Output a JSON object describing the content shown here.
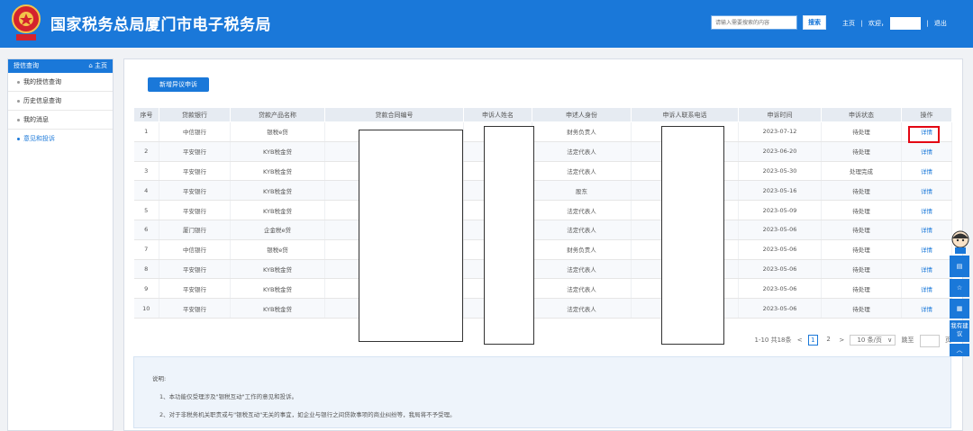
{
  "header": {
    "title": "国家税务总局厦门市电子税务局",
    "search_placeholder": "请输入需要搜索的内容",
    "search_button": "搜索",
    "nav_home": "主页",
    "nav_welcome": "欢迎，",
    "nav_logout": "退出",
    "sep": "|"
  },
  "sidebar": {
    "header": "授信查询",
    "home_link": "主页",
    "items": [
      {
        "label": "我的授信查询"
      },
      {
        "label": "历史信息查询"
      },
      {
        "label": "我的消息"
      },
      {
        "label": "意见和投诉"
      }
    ]
  },
  "main": {
    "new_button": "新增异议申诉",
    "columns": [
      "序号",
      "贷款银行",
      "贷款产品名称",
      "贷款合同编号",
      "申诉人姓名",
      "申述人身份",
      "申诉人联系电话",
      "申诉时间",
      "申诉状态",
      "操作"
    ],
    "rows": [
      {
        "no": "1",
        "bank": "中信银行",
        "product": "银税e贷",
        "role": "财务负责人",
        "date": "2023-07-12",
        "status": "待处理",
        "action": "详情"
      },
      {
        "no": "2",
        "bank": "平安银行",
        "product": "KYB税金贷",
        "role": "法定代表人",
        "date": "2023-06-20",
        "status": "待处理",
        "action": "详情"
      },
      {
        "no": "3",
        "bank": "平安银行",
        "product": "KYB税金贷",
        "role": "法定代表人",
        "date": "2023-05-30",
        "status": "处理完成",
        "action": "详情"
      },
      {
        "no": "4",
        "bank": "平安银行",
        "product": "KYB税金贷",
        "role": "股东",
        "date": "2023-05-16",
        "status": "待处理",
        "action": "详情"
      },
      {
        "no": "5",
        "bank": "平安银行",
        "product": "KYB税金贷",
        "role": "法定代表人",
        "date": "2023-05-09",
        "status": "待处理",
        "action": "详情"
      },
      {
        "no": "6",
        "bank": "厦门银行",
        "product": "企金税e贷",
        "role": "法定代表人",
        "date": "2023-05-06",
        "status": "待处理",
        "action": "详情"
      },
      {
        "no": "7",
        "bank": "中信银行",
        "product": "银税e贷",
        "role": "财务负责人",
        "date": "2023-05-06",
        "status": "待处理",
        "action": "详情"
      },
      {
        "no": "8",
        "bank": "平安银行",
        "product": "KYB税金贷",
        "role": "法定代表人",
        "date": "2023-05-06",
        "status": "待处理",
        "action": "详情"
      },
      {
        "no": "9",
        "bank": "平安银行",
        "product": "KYB税金贷",
        "role": "法定代表人",
        "date": "2023-05-06",
        "status": "待处理",
        "action": "详情"
      },
      {
        "no": "10",
        "bank": "平安银行",
        "product": "KYB税金贷",
        "role": "法定代表人",
        "date": "2023-05-06",
        "status": "待处理",
        "action": "详情"
      }
    ],
    "pagination": {
      "summary": "1-10 共18条",
      "prev": "<",
      "page1": "1",
      "page2": "2",
      "next": ">",
      "page_size": "10 条/页",
      "jump_label": "跳至",
      "page_unit": "页"
    },
    "notes": {
      "title": "说明:",
      "line1": "1、本功能仅受理涉及\"银税互动\"工作的意见和投诉。",
      "line2": "2、对于非税务机关职责或与\"银税互动\"无关的事宜，如企业与银行之间贷款事项的商业纠纷等，我局将不予受理。"
    }
  },
  "float_tools": {
    "suggest_label": "我有建议"
  },
  "colors": {
    "primary": "#1a78d9",
    "highlight": "#e30613"
  }
}
